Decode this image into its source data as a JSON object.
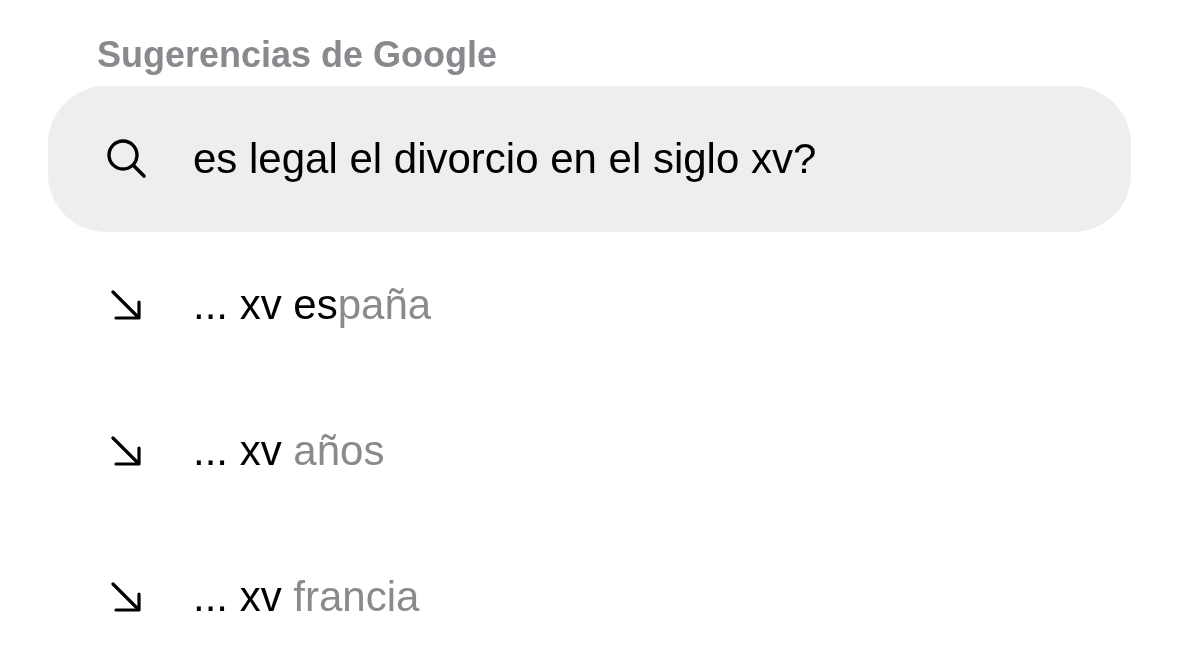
{
  "section_title": "Sugerencias de Google",
  "suggestions": [
    {
      "kind": "search",
      "text": "es legal el divorcio en el siglo xv?",
      "selected": true
    },
    {
      "kind": "completion",
      "typed": "... xv es",
      "completion": "paña",
      "selected": false
    },
    {
      "kind": "completion",
      "typed": "... xv",
      "completion": " años",
      "selected": false
    },
    {
      "kind": "completion",
      "typed": "... xv",
      "completion": " francia",
      "selected": false
    }
  ]
}
